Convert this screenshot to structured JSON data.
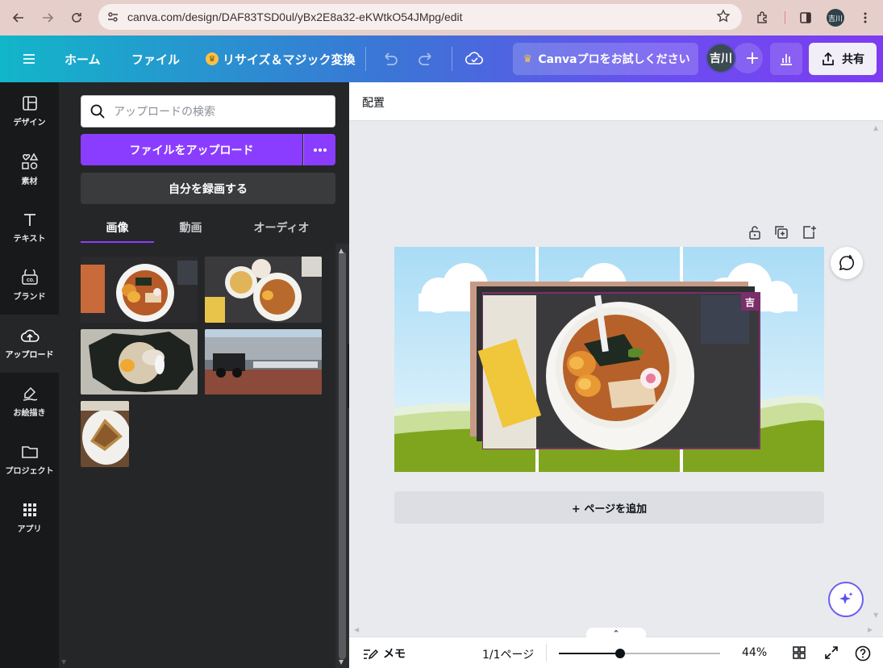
{
  "browser": {
    "url": "canva.com/design/DAF83TSD0ul/yBx2E8a32-eKWtkO54JMpg/edit",
    "profile_initials": "吉川"
  },
  "header": {
    "home": "ホーム",
    "file": "ファイル",
    "resize": "リサイズ＆マジック変換",
    "pro_trial": "Canvaプロをお試しください",
    "avatar": "吉川",
    "share": "共有"
  },
  "rail": {
    "items": [
      {
        "label": "デザイン",
        "icon": "layout-icon"
      },
      {
        "label": "素材",
        "icon": "elements-icon"
      },
      {
        "label": "テキスト",
        "icon": "text-icon"
      },
      {
        "label": "ブランド",
        "icon": "brand-icon"
      },
      {
        "label": "アップロード",
        "icon": "upload-cloud-icon"
      },
      {
        "label": "お絵描き",
        "icon": "draw-icon"
      },
      {
        "label": "プロジェクト",
        "icon": "folder-icon"
      },
      {
        "label": "アプリ",
        "icon": "apps-grid-icon"
      }
    ]
  },
  "panel": {
    "search_placeholder": "アップロードの検索",
    "upload_button": "ファイルをアップロード",
    "record_button": "自分を録画する",
    "tabs": [
      "画像",
      "動画",
      "オーディオ"
    ],
    "active_tab": "画像"
  },
  "editor": {
    "toolbar_label": "配置",
    "add_page": "+ ページを追加",
    "owner_badge": "吉",
    "footer": {
      "memo": "メモ",
      "pages": "1/1ページ",
      "zoom": "44%",
      "zoom_level": 0.38
    }
  },
  "colors": {
    "accent": "#8b3dff",
    "panel_bg": "#252627",
    "rail_bg": "#18191b"
  }
}
